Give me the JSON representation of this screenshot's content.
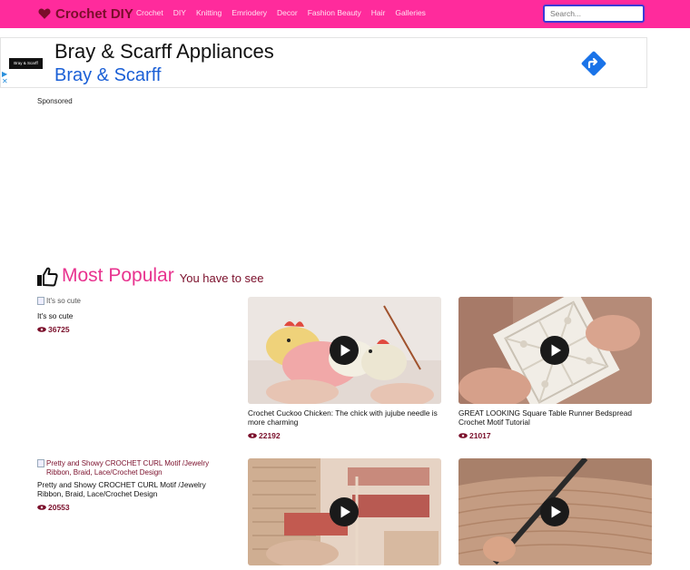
{
  "brand": "Crochet DIY",
  "nav": [
    "Crochet",
    "DIY",
    "Knitting",
    "Emriodery",
    "Decor",
    "Fashion Beauty",
    "Hair",
    "Galleries"
  ],
  "search": {
    "placeholder": "Search..."
  },
  "ad": {
    "logo_text": "Bray & Scarff",
    "title": "Bray & Scarff Appliances",
    "subtitle": "Bray & Scarff"
  },
  "sponsored": "Sponsored",
  "section": {
    "title": "Most Popular",
    "subtitle": "You have to see"
  },
  "cards": [
    {
      "alt": "It's so cute",
      "title": "It's so cute",
      "views": "36725"
    },
    {
      "title": "Crochet Cuckoo Chicken: The chick with jujube needle is more charming",
      "views": "22192"
    },
    {
      "title": "GREAT LOOKING Square Table Runner Bedspread Crochet Motif Tutorial",
      "views": "21017"
    },
    {
      "alt": "Pretty and Showy CROCHET CURL Motif /Jewelry Ribbon, Braid, Lace/Crochet Design",
      "title": "Pretty and Showy CROCHET CURL Motif /Jewelry Ribbon, Braid, Lace/Crochet Design",
      "views": "20553"
    },
    {
      "title": "",
      "views": ""
    },
    {
      "title": "",
      "views": ""
    }
  ],
  "colors": {
    "navbar": "#ff2b9c",
    "brand": "#7a0e2a",
    "accent": "#e8338f",
    "ad_link": "#1a5fd6"
  }
}
